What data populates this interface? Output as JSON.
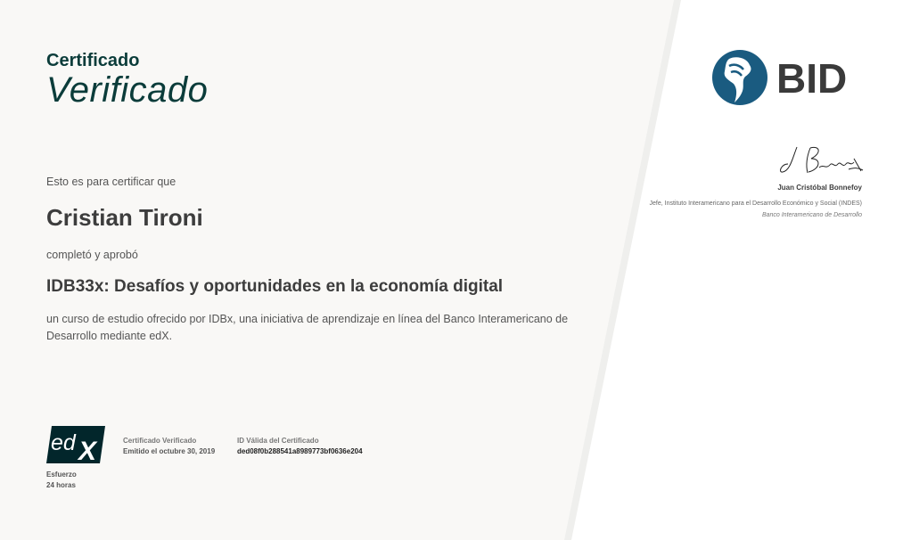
{
  "heading": {
    "line1": "Certificado",
    "line2": "Verificado"
  },
  "intro_text": "Esto es para certificar que",
  "learner_name": "Cristian Tironi",
  "completed_text": "completó y aprobó",
  "course_title": "IDB33x: Desafíos y oportunidades en la economía digital",
  "course_description": "un curso de estudio ofrecido por IDBx, una iniciativa de aprendizaje en línea del Banco Interamericano de Desarrollo mediante edX.",
  "effort": {
    "label": "Esfuerzo",
    "value": "24 horas"
  },
  "verified": {
    "label": "Certificado Verificado",
    "issued": "Emitido el octubre 30, 2019"
  },
  "certificate_id": {
    "label": "ID Válida del Certificado",
    "value": "ded08f0b288541a8989773bf0636e204"
  },
  "edx_logo_text": "edX",
  "bid_logo_text": "BID",
  "signatory": {
    "name": "Juan Cristóbal Bonnefoy",
    "title": "Jefe, Instituto Interamericano para el Desarrollo Económico y Social (INDES)",
    "organization": "Banco Interamericano de Desarrollo"
  },
  "colors": {
    "heading": "#0b3c3a",
    "left_panel": "#f9f8f6",
    "bid_blue": "#1a5b80",
    "bid_text": "#3a3a3a",
    "edx_dark": "#02262b"
  },
  "icons": [
    "edx-logo",
    "bid-globe-logo",
    "signature"
  ]
}
